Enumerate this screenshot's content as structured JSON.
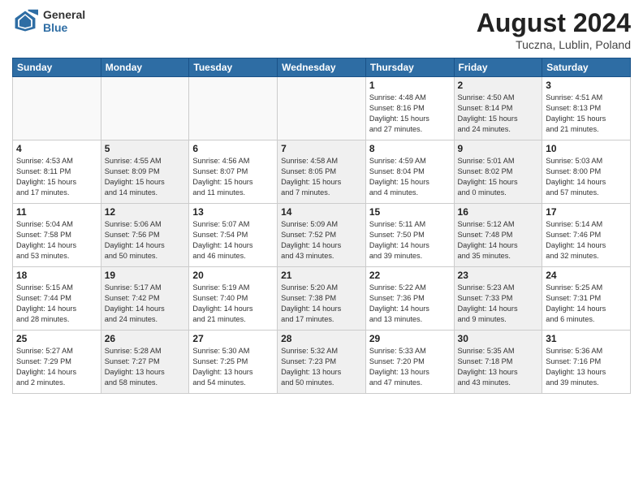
{
  "header": {
    "logo_line1": "General",
    "logo_line2": "Blue",
    "month_year": "August 2024",
    "location": "Tuczna, Lublin, Poland"
  },
  "weekdays": [
    "Sunday",
    "Monday",
    "Tuesday",
    "Wednesday",
    "Thursday",
    "Friday",
    "Saturday"
  ],
  "weeks": [
    [
      {
        "day": "",
        "info": "",
        "shaded": false,
        "empty": true
      },
      {
        "day": "",
        "info": "",
        "shaded": false,
        "empty": true
      },
      {
        "day": "",
        "info": "",
        "shaded": false,
        "empty": true
      },
      {
        "day": "",
        "info": "",
        "shaded": false,
        "empty": true
      },
      {
        "day": "1",
        "info": "Sunrise: 4:48 AM\nSunset: 8:16 PM\nDaylight: 15 hours\nand 27 minutes.",
        "shaded": false,
        "empty": false
      },
      {
        "day": "2",
        "info": "Sunrise: 4:50 AM\nSunset: 8:14 PM\nDaylight: 15 hours\nand 24 minutes.",
        "shaded": true,
        "empty": false
      },
      {
        "day": "3",
        "info": "Sunrise: 4:51 AM\nSunset: 8:13 PM\nDaylight: 15 hours\nand 21 minutes.",
        "shaded": false,
        "empty": false
      }
    ],
    [
      {
        "day": "4",
        "info": "Sunrise: 4:53 AM\nSunset: 8:11 PM\nDaylight: 15 hours\nand 17 minutes.",
        "shaded": false,
        "empty": false
      },
      {
        "day": "5",
        "info": "Sunrise: 4:55 AM\nSunset: 8:09 PM\nDaylight: 15 hours\nand 14 minutes.",
        "shaded": true,
        "empty": false
      },
      {
        "day": "6",
        "info": "Sunrise: 4:56 AM\nSunset: 8:07 PM\nDaylight: 15 hours\nand 11 minutes.",
        "shaded": false,
        "empty": false
      },
      {
        "day": "7",
        "info": "Sunrise: 4:58 AM\nSunset: 8:05 PM\nDaylight: 15 hours\nand 7 minutes.",
        "shaded": true,
        "empty": false
      },
      {
        "day": "8",
        "info": "Sunrise: 4:59 AM\nSunset: 8:04 PM\nDaylight: 15 hours\nand 4 minutes.",
        "shaded": false,
        "empty": false
      },
      {
        "day": "9",
        "info": "Sunrise: 5:01 AM\nSunset: 8:02 PM\nDaylight: 15 hours\nand 0 minutes.",
        "shaded": true,
        "empty": false
      },
      {
        "day": "10",
        "info": "Sunrise: 5:03 AM\nSunset: 8:00 PM\nDaylight: 14 hours\nand 57 minutes.",
        "shaded": false,
        "empty": false
      }
    ],
    [
      {
        "day": "11",
        "info": "Sunrise: 5:04 AM\nSunset: 7:58 PM\nDaylight: 14 hours\nand 53 minutes.",
        "shaded": false,
        "empty": false
      },
      {
        "day": "12",
        "info": "Sunrise: 5:06 AM\nSunset: 7:56 PM\nDaylight: 14 hours\nand 50 minutes.",
        "shaded": true,
        "empty": false
      },
      {
        "day": "13",
        "info": "Sunrise: 5:07 AM\nSunset: 7:54 PM\nDaylight: 14 hours\nand 46 minutes.",
        "shaded": false,
        "empty": false
      },
      {
        "day": "14",
        "info": "Sunrise: 5:09 AM\nSunset: 7:52 PM\nDaylight: 14 hours\nand 43 minutes.",
        "shaded": true,
        "empty": false
      },
      {
        "day": "15",
        "info": "Sunrise: 5:11 AM\nSunset: 7:50 PM\nDaylight: 14 hours\nand 39 minutes.",
        "shaded": false,
        "empty": false
      },
      {
        "day": "16",
        "info": "Sunrise: 5:12 AM\nSunset: 7:48 PM\nDaylight: 14 hours\nand 35 minutes.",
        "shaded": true,
        "empty": false
      },
      {
        "day": "17",
        "info": "Sunrise: 5:14 AM\nSunset: 7:46 PM\nDaylight: 14 hours\nand 32 minutes.",
        "shaded": false,
        "empty": false
      }
    ],
    [
      {
        "day": "18",
        "info": "Sunrise: 5:15 AM\nSunset: 7:44 PM\nDaylight: 14 hours\nand 28 minutes.",
        "shaded": false,
        "empty": false
      },
      {
        "day": "19",
        "info": "Sunrise: 5:17 AM\nSunset: 7:42 PM\nDaylight: 14 hours\nand 24 minutes.",
        "shaded": true,
        "empty": false
      },
      {
        "day": "20",
        "info": "Sunrise: 5:19 AM\nSunset: 7:40 PM\nDaylight: 14 hours\nand 21 minutes.",
        "shaded": false,
        "empty": false
      },
      {
        "day": "21",
        "info": "Sunrise: 5:20 AM\nSunset: 7:38 PM\nDaylight: 14 hours\nand 17 minutes.",
        "shaded": true,
        "empty": false
      },
      {
        "day": "22",
        "info": "Sunrise: 5:22 AM\nSunset: 7:36 PM\nDaylight: 14 hours\nand 13 minutes.",
        "shaded": false,
        "empty": false
      },
      {
        "day": "23",
        "info": "Sunrise: 5:23 AM\nSunset: 7:33 PM\nDaylight: 14 hours\nand 9 minutes.",
        "shaded": true,
        "empty": false
      },
      {
        "day": "24",
        "info": "Sunrise: 5:25 AM\nSunset: 7:31 PM\nDaylight: 14 hours\nand 6 minutes.",
        "shaded": false,
        "empty": false
      }
    ],
    [
      {
        "day": "25",
        "info": "Sunrise: 5:27 AM\nSunset: 7:29 PM\nDaylight: 14 hours\nand 2 minutes.",
        "shaded": false,
        "empty": false
      },
      {
        "day": "26",
        "info": "Sunrise: 5:28 AM\nSunset: 7:27 PM\nDaylight: 13 hours\nand 58 minutes.",
        "shaded": true,
        "empty": false
      },
      {
        "day": "27",
        "info": "Sunrise: 5:30 AM\nSunset: 7:25 PM\nDaylight: 13 hours\nand 54 minutes.",
        "shaded": false,
        "empty": false
      },
      {
        "day": "28",
        "info": "Sunrise: 5:32 AM\nSunset: 7:23 PM\nDaylight: 13 hours\nand 50 minutes.",
        "shaded": true,
        "empty": false
      },
      {
        "day": "29",
        "info": "Sunrise: 5:33 AM\nSunset: 7:20 PM\nDaylight: 13 hours\nand 47 minutes.",
        "shaded": false,
        "empty": false
      },
      {
        "day": "30",
        "info": "Sunrise: 5:35 AM\nSunset: 7:18 PM\nDaylight: 13 hours\nand 43 minutes.",
        "shaded": true,
        "empty": false
      },
      {
        "day": "31",
        "info": "Sunrise: 5:36 AM\nSunset: 7:16 PM\nDaylight: 13 hours\nand 39 minutes.",
        "shaded": false,
        "empty": false
      }
    ]
  ]
}
